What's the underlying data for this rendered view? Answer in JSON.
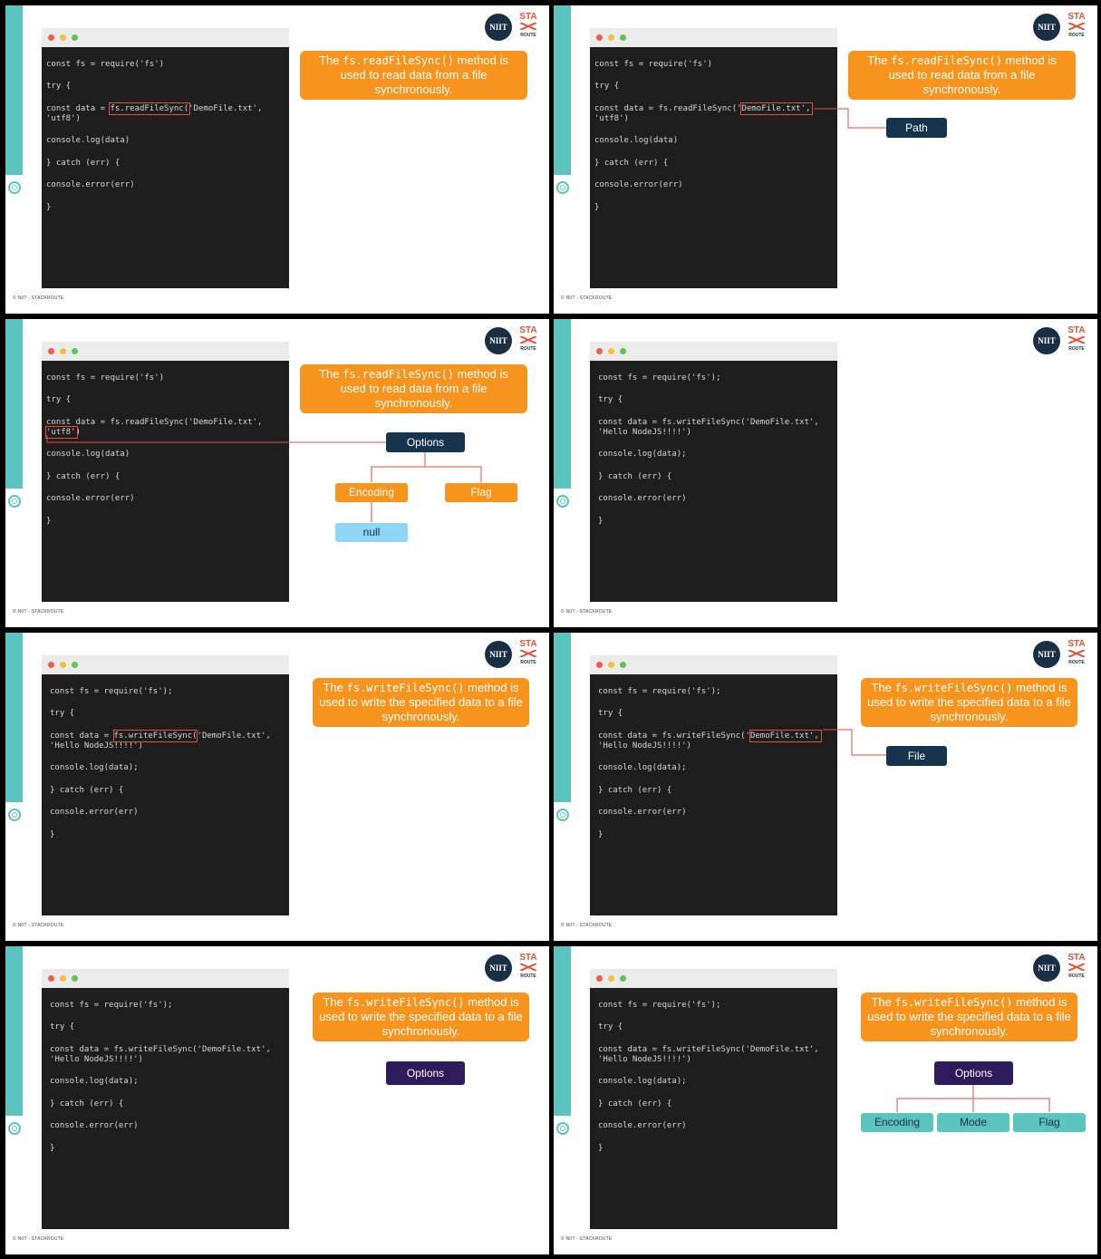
{
  "branding": {
    "niit_logo": "NIIT",
    "stackroute_logo_top": "STA",
    "stackroute_logo_bottom": "ROUTE",
    "copyright": "© NIIT - STACKROUTE",
    "accent_color": "#5bc4bf",
    "callout_color": "#f7941d"
  },
  "code_read": {
    "line1": "const fs = require('fs')",
    "line2": "try {",
    "line3a": "const data = fs.readFileSync('DemoFile.txt',",
    "line3b": "'utf8')",
    "line4": "console.log(data)",
    "line5": "} catch (err) {",
    "line6": "console.error(err)",
    "line7": "}"
  },
  "code_write": {
    "line1": "const fs = require('fs');",
    "line2": "try {",
    "line3a": "const data = fs.writeFileSync('DemoFile.txt',",
    "line3b": "'Hello NodeJS!!!!')",
    "line4": "console.log(data);",
    "line5": "} catch (err) {",
    "line6": "console.error(err)",
    "line7": "}"
  },
  "callouts": {
    "read_pre": "The ",
    "read_code": "fs.readFileSync()",
    "read_post": " method is used to read data from a file synchronously.",
    "write_pre": "The ",
    "write_code": "fs.writeFileSync()",
    "write_post": " method is used to write the specified data to a file synchronously."
  },
  "labels": {
    "path": "Path",
    "options": "Options",
    "encoding": "Encoding",
    "flag": "Flag",
    "null": "null",
    "file": "File",
    "mode": "Mode"
  }
}
